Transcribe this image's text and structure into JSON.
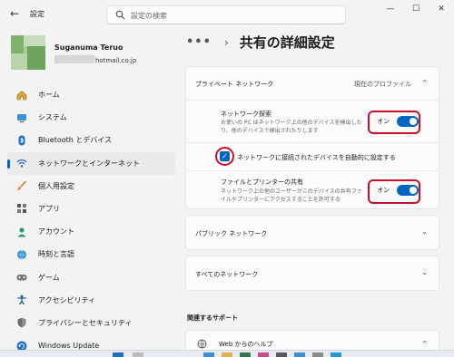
{
  "window": {
    "title": "設定",
    "back": "←",
    "minimize": "—",
    "maximize": "☐",
    "close": "✕"
  },
  "search": {
    "placeholder": "設定の検索"
  },
  "user": {
    "name": "Suganuma Teruo",
    "email_domain": "hotmail.co.jp"
  },
  "nav": {
    "items": [
      {
        "label": "ホーム",
        "icon": "home-icon"
      },
      {
        "label": "システム",
        "icon": "system-icon"
      },
      {
        "label": "Bluetooth とデバイス",
        "icon": "bluetooth-icon"
      },
      {
        "label": "ネットワークとインターネット",
        "icon": "wifi-icon",
        "active": true
      },
      {
        "label": "個人用設定",
        "icon": "brush-icon"
      },
      {
        "label": "アプリ",
        "icon": "apps-icon"
      },
      {
        "label": "アカウント",
        "icon": "account-icon"
      },
      {
        "label": "時刻と言語",
        "icon": "globe-clock-icon"
      },
      {
        "label": "ゲーム",
        "icon": "gamepad-icon"
      },
      {
        "label": "アクセシビリティ",
        "icon": "accessibility-icon"
      },
      {
        "label": "プライバシーとセキュリティ",
        "icon": "shield-icon"
      },
      {
        "label": "Windows Update",
        "icon": "update-icon"
      }
    ]
  },
  "breadcrumb": {
    "dots": "•••",
    "separator": "›",
    "title": "共有の詳細設定"
  },
  "private": {
    "title": "プライベート ネットワーク",
    "current": "現在のプロファイル",
    "discovery": {
      "title": "ネットワーク探索",
      "desc": "お使いの PC はネットワーク上の他のデバイスを検出したり、他のデバイスで検出されたりします",
      "state": "オン"
    },
    "auto_setup": {
      "label": "ネットワークに接続されたデバイスを自動的に設定する",
      "checked": true
    },
    "sharing": {
      "title": "ファイルとプリンターの共有",
      "desc": "ネットワーク上の他のユーザーがこのデバイスの共有ファイルやプリンターにアクセスすることを許可する",
      "state": "オン"
    }
  },
  "public": {
    "title": "パブリック ネットワーク"
  },
  "all": {
    "title": "すべてのネットワーク"
  },
  "support": {
    "title": "関連するサポート",
    "help": "Web からのヘルプ"
  },
  "colors": {
    "accent": "#0067c0",
    "highlight": "#c8102e"
  }
}
